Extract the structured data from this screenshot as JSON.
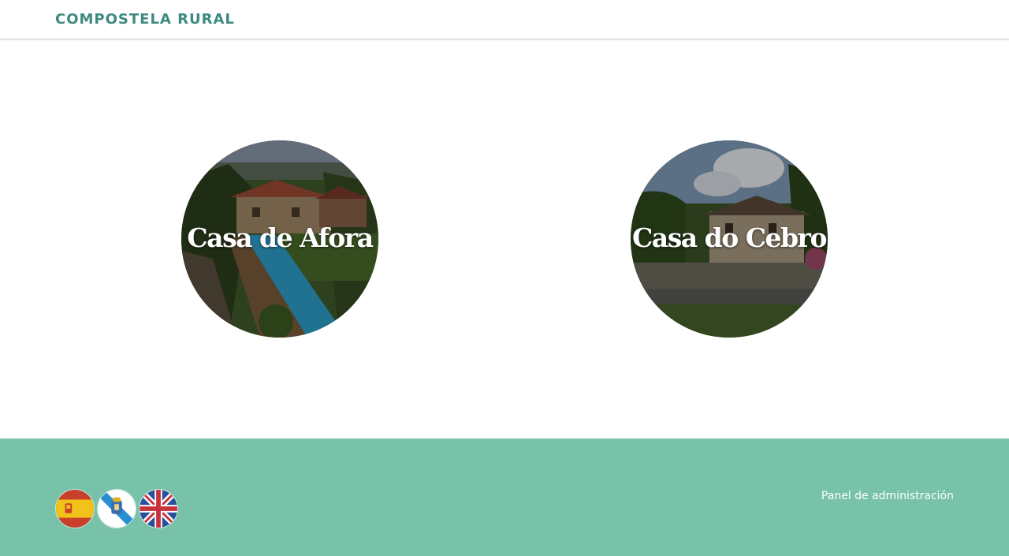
{
  "header": {
    "brand": "COMPOSTELA RURAL"
  },
  "houses": [
    {
      "name": "Casa de Afora"
    },
    {
      "name": "Casa do Cebro"
    }
  ],
  "footer": {
    "languages": [
      {
        "label": "Español",
        "icon": "spain-flag-icon"
      },
      {
        "label": "Galego",
        "icon": "galicia-flag-icon"
      },
      {
        "label": "English",
        "icon": "uk-flag-icon"
      }
    ],
    "admin_link": "Panel de administración"
  },
  "colors": {
    "brand": "#3d8a80",
    "footer_bg": "#78c2aa"
  }
}
